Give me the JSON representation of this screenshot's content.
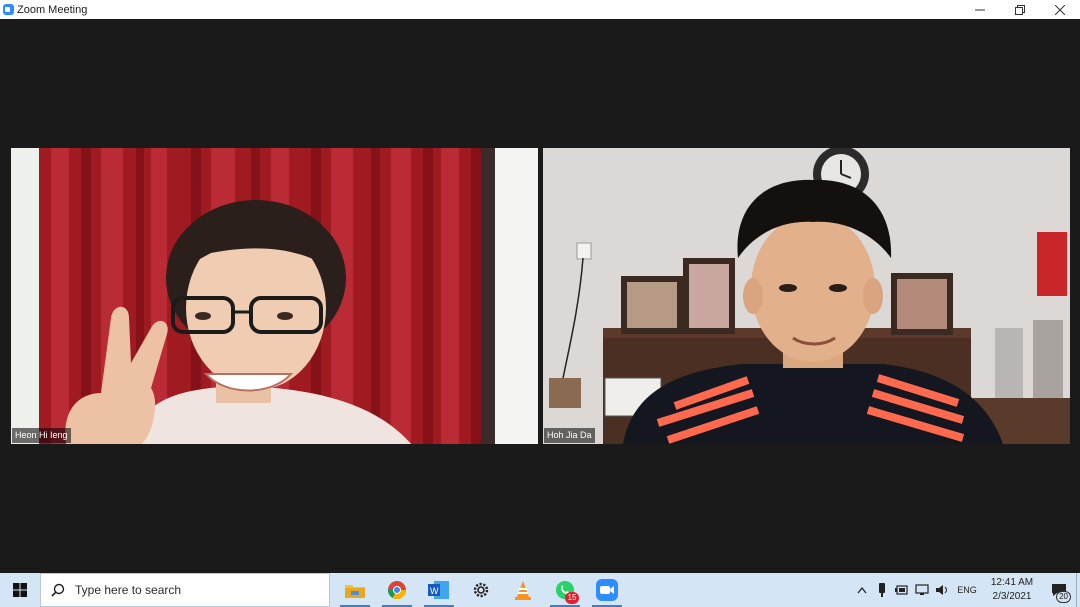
{
  "window": {
    "title": "Zoom Meeting",
    "icon": "zoom-camera-icon",
    "controls": [
      "minimize-icon",
      "restore-icon",
      "close-icon"
    ]
  },
  "participants": [
    {
      "name": "Heon Hi Ieng",
      "position": "left"
    },
    {
      "name": "Hoh Jia Da",
      "position": "right"
    }
  ],
  "taskbar": {
    "search_placeholder": "Type here to search",
    "pinned_apps": [
      {
        "name": "File Explorer",
        "icon": "folder-icon",
        "active": true
      },
      {
        "name": "Google Chrome",
        "icon": "chrome-icon",
        "active": true
      },
      {
        "name": "Microsoft Word",
        "icon": "word-icon",
        "active": true
      },
      {
        "name": "Settings",
        "icon": "gear-icon",
        "active": false
      },
      {
        "name": "VLC",
        "icon": "vlc-cone-icon",
        "active": false
      },
      {
        "name": "WhatsApp",
        "icon": "whatsapp-icon",
        "active": true,
        "badge": "15"
      },
      {
        "name": "Zoom",
        "icon": "zoom-icon",
        "active": true
      }
    ],
    "tray": {
      "language": "ENG",
      "time": "12:41 AM",
      "date": "2/3/2021",
      "notification_count": "20"
    }
  },
  "colors": {
    "meeting_background": "#1a1a1a",
    "taskbar": "#d4e5f5",
    "zoom_blue": "#2d8cff"
  }
}
